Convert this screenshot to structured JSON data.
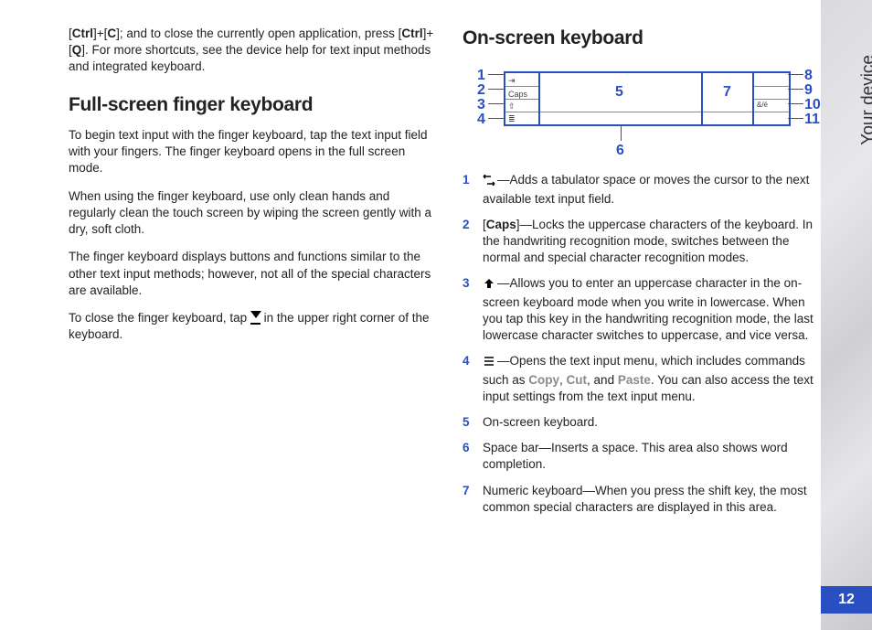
{
  "section_tab": "Your device",
  "page_number": "12",
  "left": {
    "intro": {
      "k1": "Ctrl",
      "k2": "C",
      "k3": "Ctrl",
      "k4": "Q",
      "text1": "; and to close the currently open application, press ",
      "text2": ". For more shortcuts, see the device help for text input methods and integrated keyboard."
    },
    "h2": "Full-screen finger keyboard",
    "p1": "To begin text input with the finger keyboard, tap the text input field with your fingers. The finger keyboard opens in the full screen mode.",
    "p2": "When using the finger keyboard, use only clean hands and regularly clean the touch screen by wiping the screen gently with a dry, soft cloth.",
    "p3": "The finger keyboard displays buttons and functions similar to the other text input methods; however, not all of the special characters are available.",
    "p4a": "To close the finger keyboard, tap ",
    "p4b": " in the upper right corner of the keyboard."
  },
  "right": {
    "h2": "On-screen keyboard",
    "diagram": {
      "caps": "Caps",
      "alt": "&/é",
      "call_1": "1",
      "call_2": "2",
      "call_3": "3",
      "call_4": "4",
      "call_5": "5",
      "call_6": "6",
      "call_7": "7",
      "call_8": "8",
      "call_9": "9",
      "call_10": "10",
      "call_11": "11"
    },
    "legend": [
      {
        "n": "1",
        "pre_icon": "tab",
        "text": "—Adds a tabulator space or moves the cursor to the next available text input field."
      },
      {
        "n": "2",
        "bracket": "Caps",
        "text": "—Locks the uppercase characters of the keyboard. In the handwriting recognition mode, switches between the normal and special character recognition modes."
      },
      {
        "n": "3",
        "pre_icon": "shift",
        "text": "—Allows you to enter an uppercase character in the on-screen keyboard mode when you write in lowercase. When you tap this key in the handwriting recognition mode, the last lowercase character switches to uppercase, and vice versa."
      },
      {
        "n": "4",
        "pre_icon": "menu",
        "text_a": "—Opens the text input menu, which includes commands such as ",
        "copy": "Copy",
        "cut": "Cut",
        "paste": "Paste",
        "text_b": ". You can also access the text input settings from the text input menu."
      },
      {
        "n": "5",
        "text": "On-screen keyboard."
      },
      {
        "n": "6",
        "text": "Space bar—Inserts a space. This area also shows word completion."
      },
      {
        "n": "7",
        "text": "Numeric keyboard—When you press the shift key, the most common special characters are displayed in this area."
      }
    ]
  }
}
